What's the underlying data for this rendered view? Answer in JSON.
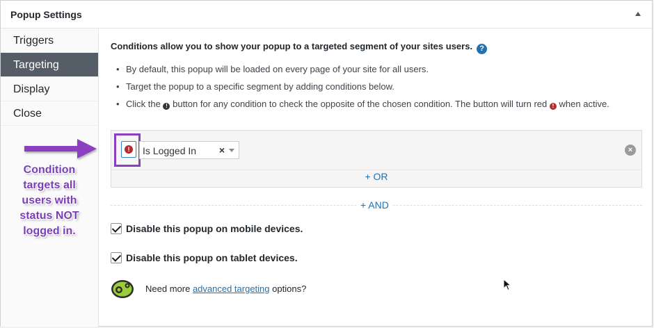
{
  "panel": {
    "title": "Popup Settings"
  },
  "sidebar": {
    "items": [
      {
        "label": "Triggers",
        "active": false
      },
      {
        "label": "Targeting",
        "active": true
      },
      {
        "label": "Display",
        "active": false
      },
      {
        "label": "Close",
        "active": false
      }
    ]
  },
  "annotation": {
    "text": "Condition targets all users with status NOT logged in.",
    "color": "#7a3db8"
  },
  "content": {
    "intro": "Conditions allow you to show your popup to a targeted segment of your sites users.",
    "help_icon": "?",
    "bullets": [
      "By default, this popup will be loaded on every page of your site for all users.",
      "Target the popup to a specific segment by adding conditions below."
    ],
    "bullet3": {
      "pre": "Click the",
      "mid": "button for any condition to check the opposite of the chosen condition. The button will turn red",
      "post": "when active."
    },
    "condition": {
      "not_icon": "!",
      "value": "Is Logged In",
      "clear": "×",
      "remove": "×",
      "or_label": "+ OR"
    },
    "and_label": "+ AND",
    "checkboxes": [
      {
        "label": "Disable this popup on mobile devices.",
        "checked": true
      },
      {
        "label": "Disable this popup on tablet devices.",
        "checked": true
      }
    ],
    "more": {
      "pre": "Need more",
      "link": "advanced targeting",
      "post": "options?"
    }
  },
  "colors": {
    "accent": "#2271b1",
    "active_nav": "#555d66",
    "not_active": "#b32d2e",
    "highlight": "#8a3fbf"
  }
}
